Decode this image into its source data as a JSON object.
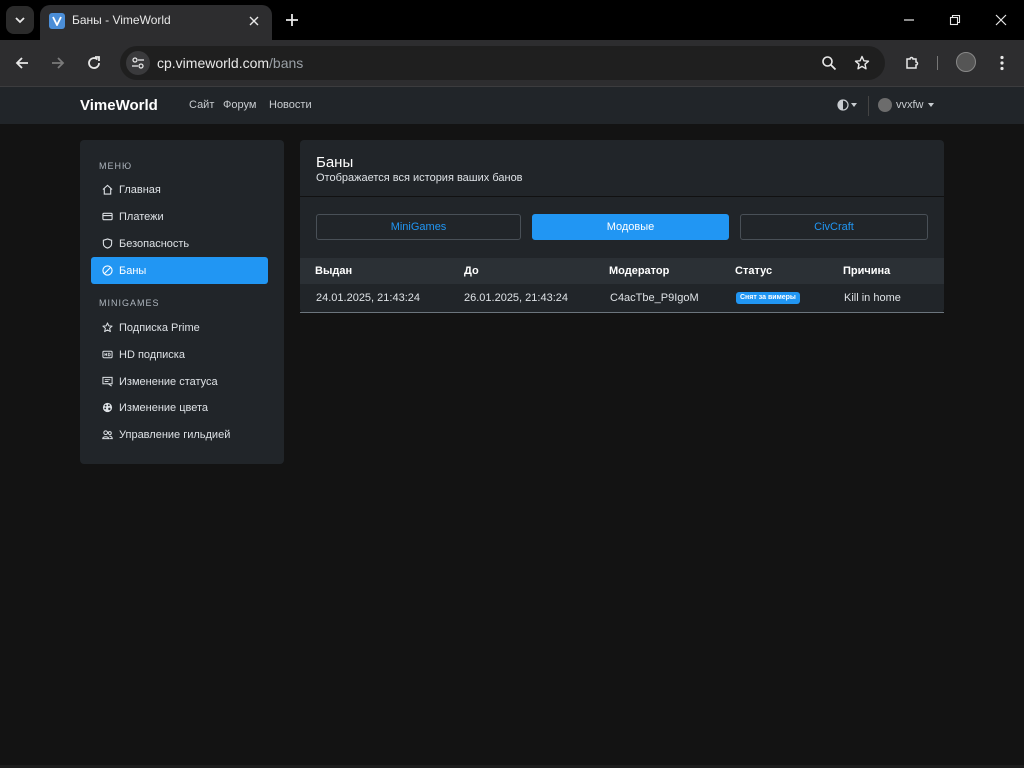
{
  "browser": {
    "tab_title": "Баны - VimeWorld",
    "url_host": "cp.vimeworld.com",
    "url_path": "/bans"
  },
  "site": {
    "brand": "VimeWorld",
    "nav": [
      "Сайт",
      "Форум",
      "Новости"
    ],
    "username": "vvxfw"
  },
  "sidebar": {
    "menu_heading": "МЕНЮ",
    "menu_items": [
      {
        "label": "Главная",
        "icon": "home-icon"
      },
      {
        "label": "Платежи",
        "icon": "card-icon"
      },
      {
        "label": "Безопасность",
        "icon": "shield-icon"
      },
      {
        "label": "Баны",
        "icon": "ban-icon",
        "active": true
      }
    ],
    "minigames_heading": "MINIGAMES",
    "minigames_items": [
      {
        "label": "Подписка Prime",
        "icon": "star-icon"
      },
      {
        "label": "HD подписка",
        "icon": "hd-icon"
      },
      {
        "label": "Изменение статуса",
        "icon": "status-icon"
      },
      {
        "label": "Изменение цвета",
        "icon": "palette-icon"
      },
      {
        "label": "Управление гильдией",
        "icon": "people-icon"
      }
    ]
  },
  "main": {
    "title": "Баны",
    "subtitle": "Отображается вся история ваших банов",
    "modes": [
      {
        "label": "MiniGames",
        "active": false
      },
      {
        "label": "Модовые",
        "active": true
      },
      {
        "label": "CivCraft",
        "active": false
      }
    ],
    "table": {
      "headers": [
        "Выдан",
        "До",
        "Модератор",
        "Статус",
        "Причина"
      ],
      "rows": [
        {
          "issued": "24.01.2025, 21:43:24",
          "until": "26.01.2025, 21:43:24",
          "moderator": "C4acTbe_P9IgoM",
          "status": "Снят за вимеры",
          "reason": "Kill in home"
        }
      ]
    }
  },
  "colors": {
    "accent": "#2196f3",
    "panel": "#212529",
    "page_bg": "#131313"
  }
}
